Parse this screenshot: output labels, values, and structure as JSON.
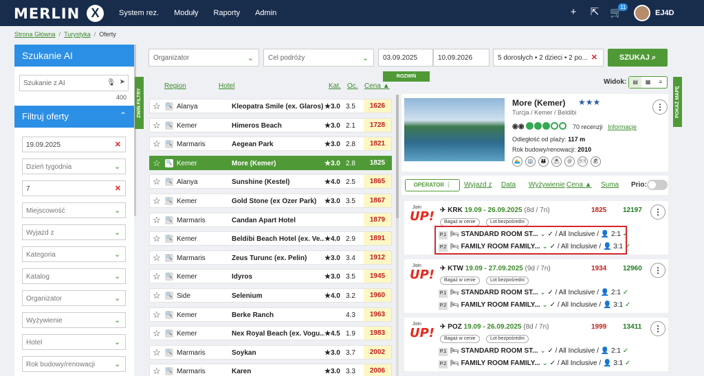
{
  "header": {
    "logo": "MERLIN",
    "logo_mark": "X",
    "nav": [
      "System rez.",
      "Moduły",
      "Raporty",
      "Admin"
    ],
    "cart_count": "11",
    "user": "EJ4D"
  },
  "breadcrumb": {
    "home": "Strona Główna",
    "section": "Turystyka",
    "current": "Oferty"
  },
  "sidebar": {
    "ai_title": "Szukanie AI",
    "ai_placeholder": "Szukanie z AI",
    "ai_count": "400",
    "filters_title": "Filtruj oferty",
    "fields": [
      {
        "value": "19.09.2025",
        "type": "clear"
      },
      {
        "value": "Dzień tygodnia",
        "type": "dropdown"
      },
      {
        "value": "7",
        "type": "clear"
      },
      {
        "value": "Miejscowość",
        "type": "dropdown"
      },
      {
        "value": "Wyjazd z",
        "type": "dropdown"
      },
      {
        "value": "Kategoria",
        "type": "dropdown"
      },
      {
        "value": "Katalog",
        "type": "dropdown"
      },
      {
        "value": "Organizator",
        "type": "dropdown"
      },
      {
        "value": "Wyżywienie",
        "type": "dropdown"
      },
      {
        "value": "Hotel",
        "type": "dropdown"
      },
      {
        "value": "Rok budowy/renowacji",
        "type": "dropdown"
      }
    ],
    "collapse_label": "ZWIŃ FILTRY"
  },
  "search": {
    "organizer": "Organizator",
    "destination": "Cel podróży",
    "date_from": "03.09.2025",
    "date_to": "10.09.2026",
    "guests": "5 dorosłych • 2 dzieci • 2 po...",
    "button": "SZUKAJ",
    "expand": "ROZWIŃ"
  },
  "list": {
    "headers": {
      "region": "Region",
      "hotel": "Hotel",
      "kat": "Kat.",
      "oc": "Oc.",
      "cena": "Cena"
    },
    "rows": [
      {
        "region": "Alanya",
        "hotel": "Kleopatra Smile (ex. Glaros)",
        "kat": "★3.0",
        "oc": "3.5",
        "price": "1626"
      },
      {
        "region": "Kemer",
        "hotel": "Himeros Beach",
        "kat": "★3.0",
        "oc": "2.1",
        "price": "1728"
      },
      {
        "region": "Marmaris",
        "hotel": "Aegean Park",
        "kat": "★3.0",
        "oc": "2.8",
        "price": "1821"
      },
      {
        "region": "Kemer",
        "hotel": "More (Kemer)",
        "kat": "★3.0",
        "oc": "2.8",
        "price": "1825",
        "selected": true
      },
      {
        "region": "Alanya",
        "hotel": "Sunshine (Kestel)",
        "kat": "★4.0",
        "oc": "2.5",
        "price": "1865"
      },
      {
        "region": "Kemer",
        "hotel": "Gold Stone (ex Ozer Park)",
        "kat": "★3.0",
        "oc": "3.5",
        "price": "1867"
      },
      {
        "region": "Marmaris",
        "hotel": "Candan Apart Hotel",
        "kat": "",
        "oc": "",
        "price": "1879"
      },
      {
        "region": "Kemer",
        "hotel": "Beldibi Beach Hotel (ex. Ve...",
        "kat": "★4.0",
        "oc": "2.9",
        "price": "1891"
      },
      {
        "region": "Marmaris",
        "hotel": "Zeus Turunc (ex. Pelin)",
        "kat": "★3.0",
        "oc": "3.4",
        "price": "1912"
      },
      {
        "region": "Kemer",
        "hotel": "Idyros",
        "kat": "★3.0",
        "oc": "3.5",
        "price": "1945"
      },
      {
        "region": "Side",
        "hotel": "Selenium",
        "kat": "★4.0",
        "oc": "3.2",
        "price": "1960"
      },
      {
        "region": "Kemer",
        "hotel": "Berke Ranch",
        "kat": "",
        "oc": "4.3",
        "price": "1963"
      },
      {
        "region": "Kemer",
        "hotel": "Nex Royal Beach (ex. Vogu...",
        "kat": "★4.5",
        "oc": "1.9",
        "price": "1983"
      },
      {
        "region": "Marmaris",
        "hotel": "Soykan",
        "kat": "★3.0",
        "oc": "3.7",
        "price": "2002"
      },
      {
        "region": "Marmaris",
        "hotel": "Karen",
        "kat": "★3.0",
        "oc": "3.3",
        "price": "2006"
      }
    ]
  },
  "view": {
    "label": "Widok:",
    "map_label": "POKAŻ MAPĘ"
  },
  "hotel": {
    "name": "More (Kemer)",
    "stars": "★★★",
    "location": "Turcja / Kemer / Beldibi",
    "reviews": "70 recenzji",
    "info_link": "Informacje",
    "beach_label": "Odległość od plaży:",
    "beach_value": "117 m",
    "build_label": "Rok budowy/renowacji:",
    "build_value": "2010",
    "amenities": [
      "🏊",
      "🏢",
      "👪",
      "⛱",
      "@",
      "🍽",
      "🏖"
    ]
  },
  "operator_bar": {
    "operator": "OPERATOR",
    "links": [
      "Wyjazd z",
      "Data",
      "Wyżywienie",
      "Cena ▲",
      "Suma"
    ],
    "prio": "Prio:"
  },
  "offers": [
    {
      "logo_small": "Join",
      "logo": "UP!",
      "airport": "KRK",
      "dates": "19.09 - 26.09.2025",
      "duration": "(8d / 7n)",
      "price": "1825",
      "total": "12197",
      "tags": [
        "Bagaż w cenie",
        "Lot bezpośredni"
      ],
      "rooms": [
        {
          "p": "P.1",
          "name": "STANDARD ROOM ST...",
          "board": "✓ / All Inclusive /",
          "occ": "2:1"
        },
        {
          "p": "P.2",
          "name": "FAMILY ROOM FAMILY...",
          "board": "✓ / All Inclusive /",
          "occ": "3:1"
        }
      ]
    },
    {
      "logo_small": "Join",
      "logo": "UP!",
      "airport": "KTW",
      "dates": "19.09 - 27.09.2025",
      "duration": "(9d / 7n)",
      "price": "1934",
      "total": "12960",
      "tags": [
        "Bagaż w cenie",
        "Lot bezpośredni"
      ],
      "rooms": [
        {
          "p": "P.1",
          "name": "STANDARD ROOM ST...",
          "board": "✓ / All Inclusive /",
          "occ": "2:1"
        },
        {
          "p": "P.2",
          "name": "FAMILY ROOM FAMILY...",
          "board": "✓ / All Inclusive /",
          "occ": "3:1"
        }
      ]
    },
    {
      "logo_small": "Join",
      "logo": "UP!",
      "airport": "POZ",
      "dates": "19.09 - 26.09.2025",
      "duration": "(8d / 7n)",
      "price": "1999",
      "total": "13411",
      "tags": [
        "Bagaż w cenie",
        "Lot bezpośredni"
      ],
      "rooms": [
        {
          "p": "P.1",
          "name": "STANDARD ROOM ST...",
          "board": "✓ / All Inclusive /",
          "occ": "2:1"
        },
        {
          "p": "P.2",
          "name": "FAMILY ROOM FAMILY...",
          "board": "✓ / All Inclusive /",
          "occ": "3:1"
        }
      ]
    }
  ],
  "colors": {
    "brand": "#182c4c",
    "accent": "#4f9a36",
    "blue": "#2b8fe6",
    "price_red": "#c0201a",
    "highlight": "#d7262b"
  }
}
